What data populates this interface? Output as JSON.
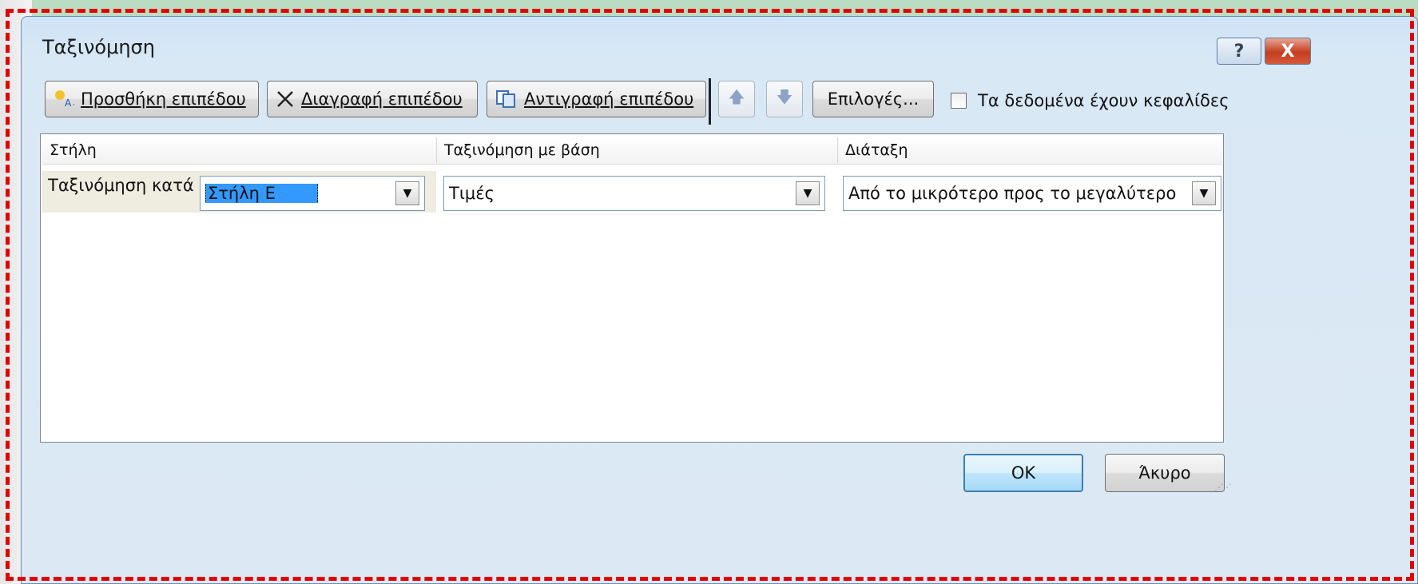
{
  "dialog": {
    "title": "Ταξινόμηση",
    "help_label": "?",
    "close_label": "X"
  },
  "toolbar": {
    "add_level_label": "Προσθήκη επιπέδου",
    "delete_level_label": "Διαγραφή επιπέδου",
    "copy_level_label": "Αντιγραφή επιπέδου",
    "options_label": "Επιλογές...",
    "header_checkbox_label": "Τα δεδομένα έχουν κεφαλίδες",
    "header_checkbox_checked": false
  },
  "grid": {
    "headers": [
      "Στήλη",
      "Ταξινόμηση με βάση",
      "Διάταξη"
    ],
    "rows": [
      {
        "label": "Ταξινόμηση κατά",
        "column": "Στήλη Ε",
        "sort_on": "Τιμές",
        "order": "Από το μικρότερο προς το μεγαλύτερο"
      }
    ]
  },
  "footer": {
    "ok_label": "OK",
    "cancel_label": "Άκυρο"
  },
  "colors": {
    "frame_dash": "#e00000",
    "selection": "#3399ff",
    "close_button": "#c33e1f"
  }
}
